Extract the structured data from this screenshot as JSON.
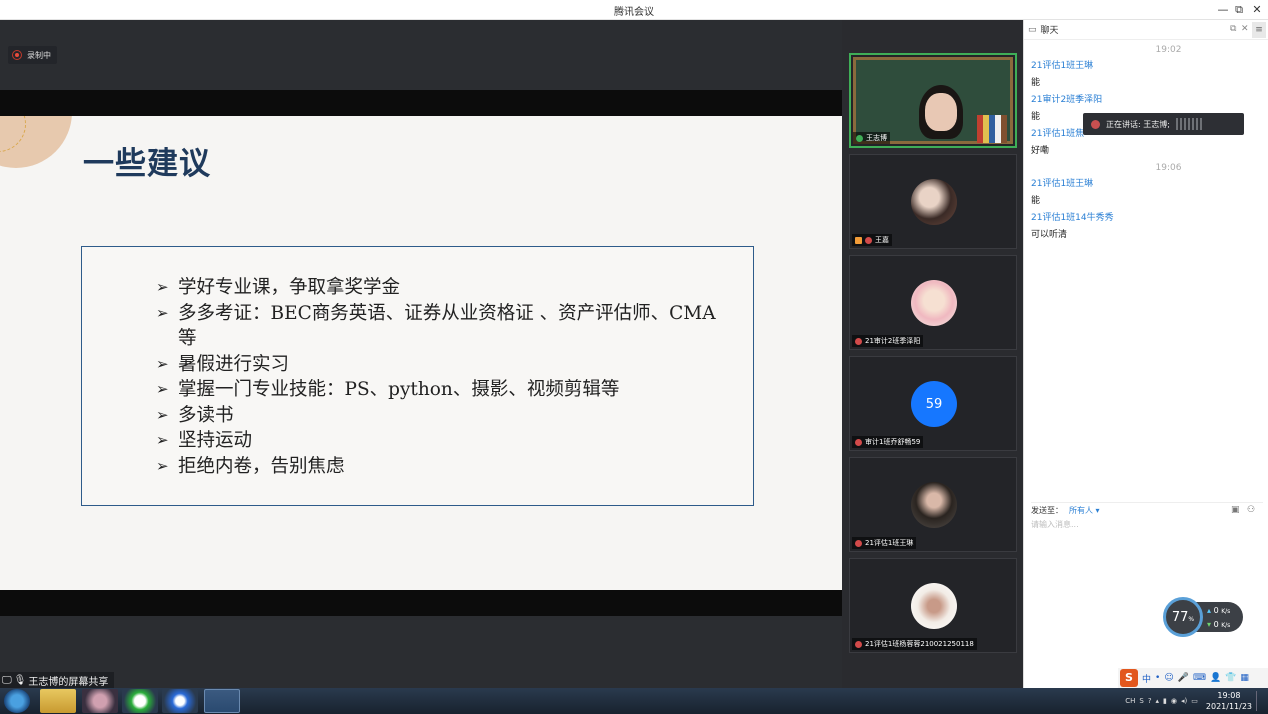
{
  "window": {
    "title": "腾讯会议",
    "minimize": "—",
    "restore": "⧉",
    "close": "✕"
  },
  "recording": {
    "label": "录制中"
  },
  "slide": {
    "title": "一些建议",
    "bullet": "➢",
    "items": [
      "学好专业课，争取拿奖学金",
      "多多考证：BEC商务英语、证券从业资格证 、资产评估师、CMA等",
      "暑假进行实习",
      "掌握一门专业技能：PS、python、摄影、视频剪辑等",
      "多读书",
      "坚持运动",
      "拒绝内卷，告别焦虑"
    ]
  },
  "share_bar": {
    "label": "王志博的屏幕共享"
  },
  "participants": [
    {
      "name": "王志博"
    },
    {
      "name": "王嘉"
    },
    {
      "name": "21审计2班季泽阳"
    },
    {
      "name": "审计1班乔舒畅59",
      "avatar_text": "59"
    },
    {
      "name": "21评估1班王琳"
    },
    {
      "name": "21评估1班杨蓉蓉210021250118"
    }
  ],
  "chat": {
    "title": "聊天",
    "messages": [
      {
        "time": "19:02"
      },
      {
        "sender": "21评估1班王琳",
        "text": "能"
      },
      {
        "sender": "21审计2班季泽阳",
        "text": "能"
      },
      {
        "sender": "21评估1班焦",
        "text": "好嘞"
      },
      {
        "time": "19:06"
      },
      {
        "sender": "21评估1班王琳",
        "text": "能"
      },
      {
        "sender": "21评估1班14牛秀秀",
        "text": "可以听清"
      }
    ],
    "send_to_label": "发送至：",
    "send_to_value": "所有人 ▾",
    "input_placeholder": "请输入消息..."
  },
  "speaking_toast": {
    "text": "正在讲话: 王志博;"
  },
  "net_monitor": {
    "percent": "77",
    "unit": "%",
    "up": "0",
    "down": "0",
    "rate_unit": "K/s"
  },
  "ime": {
    "logo": "S",
    "mode": "中",
    "items": [
      "•",
      "☺",
      "🎤",
      "⌨",
      "👤",
      "👕",
      "▦"
    ]
  },
  "taskbar": {
    "tray_lang": "CH",
    "time": "19:08",
    "date": "2021/11/23"
  }
}
